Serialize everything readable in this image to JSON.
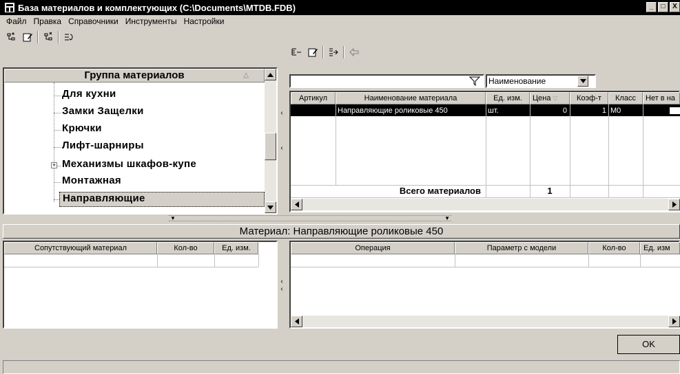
{
  "window": {
    "title": "База материалов и комплектующих  (C:\\Documents\\MTDB.FDB)",
    "minimize": "_",
    "maximize": "□",
    "close": "X"
  },
  "menu": [
    "Файл",
    "Правка",
    "Справочники",
    "Инструменты",
    "Настройки"
  ],
  "tree": {
    "header": "Группа материалов",
    "items": [
      {
        "label": "Для кухни"
      },
      {
        "label": "Замки Защелки"
      },
      {
        "label": "Крючки"
      },
      {
        "label": "Лифт-шарниры"
      },
      {
        "label": "Механизмы шкафов-купе",
        "expandable": true
      },
      {
        "label": "Монтажная"
      },
      {
        "label": "Направляющие",
        "selected": true
      }
    ]
  },
  "filter": {
    "search_value": "",
    "field_select": "Наименование"
  },
  "materials_table": {
    "columns": [
      "Артикул",
      "Наименование материала",
      "Ед. изм.",
      "Цена",
      "Коэф-т",
      "Класс",
      "Нет в на"
    ],
    "rows": [
      {
        "article": "",
        "name": "Направляющие роликовые 450",
        "unit": "шт.",
        "price": "0",
        "coef": "1",
        "class": "M0",
        "absent": ""
      }
    ],
    "total_label": "Всего материалов",
    "total_value": "1"
  },
  "material_label": "Материал: Направляющие роликовые 450",
  "companion_table": {
    "columns": [
      "Сопутствующий материал",
      "Кол-во",
      "Ед. изм."
    ]
  },
  "operations_table": {
    "columns": [
      "Операция",
      "Параметр с модели",
      "Кол-во",
      "Ед. изм"
    ]
  },
  "ok_label": "OK",
  "colors": {
    "title_bg": "#000000",
    "selection_bg": "#000000",
    "face": "#d4d0c8"
  }
}
